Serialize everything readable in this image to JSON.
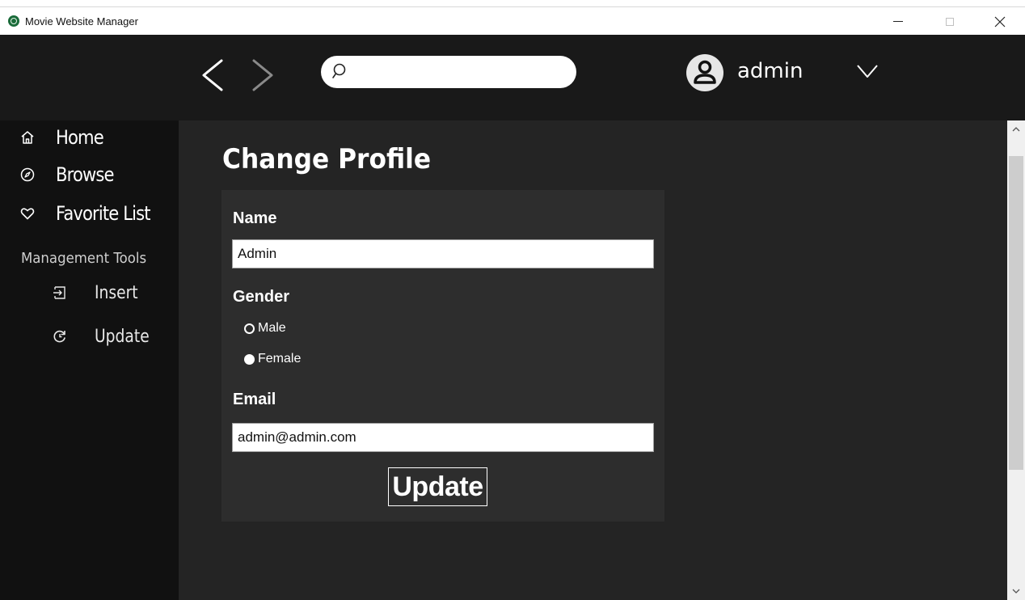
{
  "window": {
    "title": "Movie Website Manager",
    "icon": "app-logo-icon",
    "controls": [
      "minimize-icon",
      "maximize-icon",
      "close-icon"
    ]
  },
  "header": {
    "search": {
      "value": "",
      "placeholder": ""
    },
    "user": {
      "name": "admin"
    }
  },
  "sidebar": {
    "items": [
      {
        "label": "Home",
        "icon": "home-icon"
      },
      {
        "label": "Browse",
        "icon": "compass-icon"
      },
      {
        "label": "Favorite List",
        "icon": "heart-icon"
      }
    ],
    "section_label": "Management Tools",
    "tools": [
      {
        "label": "Insert",
        "icon": "sign-in-icon"
      },
      {
        "label": "Update",
        "icon": "refresh-icon"
      }
    ]
  },
  "main": {
    "title": "Change Profile",
    "form": {
      "name_label": "Name",
      "name_value": "Admin",
      "gender_label": "Gender",
      "gender_options": [
        {
          "label": "Male",
          "checked": false
        },
        {
          "label": "Female",
          "checked": true
        }
      ],
      "email_label": "Email",
      "email_value": "admin@admin.com",
      "submit_label": "Update"
    }
  },
  "colors": {
    "header_bg": "#191919",
    "sidebar_bg": "#111111",
    "main_bg": "#242424",
    "card_bg": "#2d2d2d",
    "text": "#ffffff"
  }
}
